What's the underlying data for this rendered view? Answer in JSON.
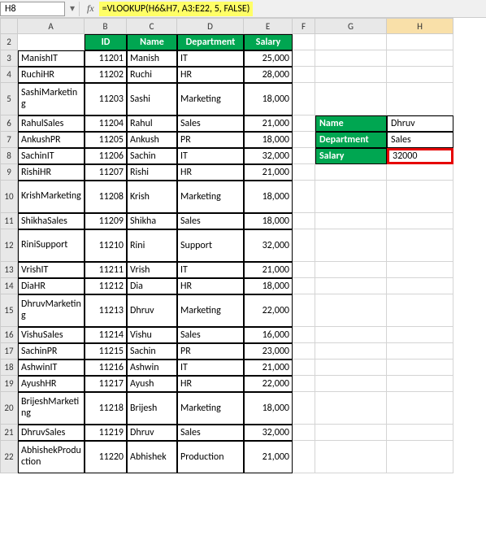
{
  "cellRef": "H8",
  "formula": "=VLOOKUP(H6&H7, A3:E22, 5, FALSE)",
  "columns": [
    "A",
    "B",
    "C",
    "D",
    "E",
    "F",
    "G",
    "H"
  ],
  "tableHeaders": {
    "id": "ID",
    "name": "Name",
    "dept": "Department",
    "salary": "Salary"
  },
  "rows": [
    {
      "rn": 3,
      "h": 20,
      "key": "ManishIT",
      "id": "11201",
      "name": "Manish",
      "dept": "IT",
      "salary": "25,000"
    },
    {
      "rn": 4,
      "h": 20,
      "key": "RuchiHR",
      "id": "11202",
      "name": "Ruchi",
      "dept": "HR",
      "salary": "28,000"
    },
    {
      "rn": 5,
      "h": 40,
      "key": "SashiMarketing",
      "id": "11203",
      "name": "Sashi",
      "dept": "Marketing",
      "salary": "18,000"
    },
    {
      "rn": 6,
      "h": 20,
      "key": "RahulSales",
      "id": "11204",
      "name": "Rahul",
      "dept": "Sales",
      "salary": "21,000"
    },
    {
      "rn": 7,
      "h": 20,
      "key": "AnkushPR",
      "id": "11205",
      "name": "Ankush",
      "dept": "PR",
      "salary": "18,000"
    },
    {
      "rn": 8,
      "h": 20,
      "key": "SachinIT",
      "id": "11206",
      "name": "Sachin",
      "dept": "IT",
      "salary": "32,000"
    },
    {
      "rn": 9,
      "h": 20,
      "key": "RishiHR",
      "id": "11207",
      "name": "Rishi",
      "dept": "HR",
      "salary": "21,000"
    },
    {
      "rn": 10,
      "h": 40,
      "key": "KrishMarketing",
      "id": "11208",
      "name": "Krish",
      "dept": "Marketing",
      "salary": "18,000"
    },
    {
      "rn": 11,
      "h": 20,
      "key": "ShikhaSales",
      "id": "11209",
      "name": "Shikha",
      "dept": "Sales",
      "salary": "18,000"
    },
    {
      "rn": 12,
      "h": 40,
      "key": "RiniSupport",
      "id": "11210",
      "name": "Rini",
      "dept": "Support",
      "salary": "32,000"
    },
    {
      "rn": 13,
      "h": 20,
      "key": "VrishIT",
      "id": "11211",
      "name": "Vrish",
      "dept": "IT",
      "salary": "21,000"
    },
    {
      "rn": 14,
      "h": 20,
      "key": "DiaHR",
      "id": "11212",
      "name": "Dia",
      "dept": "HR",
      "salary": "18,000"
    },
    {
      "rn": 15,
      "h": 40,
      "key": "DhruvMarketing",
      "id": "11213",
      "name": "Dhruv",
      "dept": "Marketing",
      "salary": "22,000"
    },
    {
      "rn": 16,
      "h": 20,
      "key": "VishuSales",
      "id": "11214",
      "name": "Vishu",
      "dept": "Sales",
      "salary": "16,000"
    },
    {
      "rn": 17,
      "h": 20,
      "key": "SachinPR",
      "id": "11215",
      "name": "Sachin",
      "dept": "PR",
      "salary": "23,000"
    },
    {
      "rn": 18,
      "h": 20,
      "key": "AshwinIT",
      "id": "11216",
      "name": "Ashwin",
      "dept": "IT",
      "salary": "21,000"
    },
    {
      "rn": 19,
      "h": 20,
      "key": "AyushHR",
      "id": "11217",
      "name": "Ayush",
      "dept": "HR",
      "salary": "22,000"
    },
    {
      "rn": 20,
      "h": 40,
      "key": "BrijeshMarketing",
      "id": "11218",
      "name": "Brijesh",
      "dept": "Marketing",
      "salary": "18,000"
    },
    {
      "rn": 21,
      "h": 20,
      "key": "DhruvSales",
      "id": "11219",
      "name": "Dhruv",
      "dept": "Sales",
      "salary": "32,000"
    },
    {
      "rn": 22,
      "h": 40,
      "key": "AbhishekProduction",
      "id": "11220",
      "name": "Abhishek",
      "dept": "Production",
      "salary": "21,000"
    }
  ],
  "lookup": {
    "nameLabel": "Name",
    "nameVal": "Dhruv",
    "deptLabel": "Department",
    "deptVal": "Sales",
    "salaryLabel": "Salary",
    "salaryVal": "32000"
  },
  "headerRowNum": "2"
}
